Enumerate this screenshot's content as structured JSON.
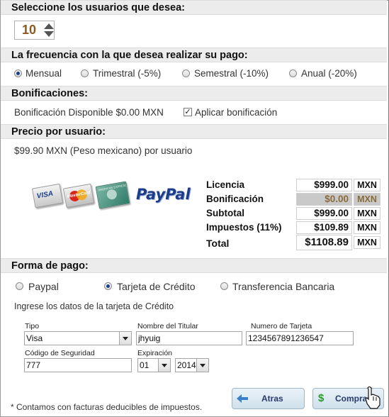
{
  "users": {
    "header": "Seleccione los usuarios que desea:",
    "count": "10"
  },
  "frequency": {
    "header": "La frecuencia con la que desea realizar su pago:",
    "options": [
      {
        "label": "Mensual",
        "selected": true
      },
      {
        "label": "Trimestral (-5%)",
        "selected": false
      },
      {
        "label": "Semestral (-10%)",
        "selected": false
      },
      {
        "label": "Anual (-20%)",
        "selected": false
      }
    ]
  },
  "bonus": {
    "header": "Bonificaciones:",
    "available": "Bonificación Disponible $0.00 MXN",
    "apply_label": "Aplicar bonificación",
    "apply_checked": true
  },
  "price": {
    "header": "Precio por usuario:",
    "per_user": "$99.90 MXN (Peso mexicano) por usuario"
  },
  "logos": {
    "visa": "VISA",
    "mastercard": "MasterCard",
    "amex": "AMERICAN EXPRESS",
    "paypal": "PayPal"
  },
  "summary": {
    "rows": [
      {
        "label": "Licencia",
        "value": "$999.00",
        "currency": "MXN"
      },
      {
        "label": "Bonificación",
        "value": "$0.00",
        "currency": "MXN"
      },
      {
        "label": "Subtotal",
        "value": "$999.00",
        "currency": "MXN"
      },
      {
        "label": "Impuestos (11%)",
        "value": "$109.89",
        "currency": "MXN"
      },
      {
        "label": "Total",
        "value": "$1108.89",
        "currency": "MXN"
      }
    ]
  },
  "payment": {
    "header": "Forma de pago:",
    "methods": [
      {
        "label": "Paypal",
        "selected": false
      },
      {
        "label": "Tarjeta de Crédito",
        "selected": true
      },
      {
        "label": "Transferencia Bancaria",
        "selected": false
      }
    ],
    "instructions": "Ingrese los datos de la tarjeta de Crédito",
    "type_label": "Tipo",
    "type_value": "Visa",
    "holder_label": "Nombre del Titular",
    "holder_value": "jhyuig",
    "card_number_label": "Numero de Tarjeta",
    "card_number_value": "1234567891236547",
    "security_label": "Código de Seguridad",
    "security_value": "777",
    "expiration_label": "Expiración",
    "exp_month": "01",
    "exp_year": "2014"
  },
  "footer": {
    "note": "* Contamos con facturas deducibles de impuestos.",
    "back_label": "Atras",
    "buy_label": "Comprar"
  },
  "colors": {
    "header_bg": "#ececec",
    "value_brown": "#8a5a22",
    "button_bg": "#d9e7f1",
    "bonus_row_bg": "#c9c9c9"
  }
}
